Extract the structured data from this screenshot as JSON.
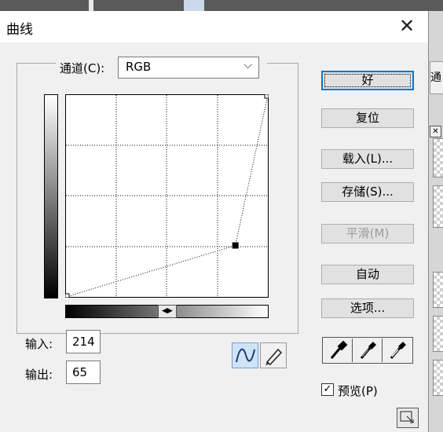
{
  "dialog": {
    "title": "曲线",
    "close_glyph": "✕"
  },
  "channel": {
    "label": "通道(C):",
    "value": "RGB"
  },
  "curve": {
    "points": [
      [
        0,
        0
      ],
      [
        214,
        65
      ],
      [
        255,
        255
      ]
    ],
    "scale_max": 255
  },
  "io": {
    "input_label": "输入:",
    "input_value": "214",
    "output_label": "输出:",
    "output_value": "65"
  },
  "buttons": {
    "ok": "好",
    "reset": "复位",
    "load": "载入(L)...",
    "save": "存储(S)...",
    "smooth": "平滑(M)",
    "auto": "自动",
    "options": "选项..."
  },
  "preview": {
    "checked": true,
    "label": "预览(P)"
  },
  "background": {
    "right_tab_glyph": "通"
  },
  "icons": {
    "curve_tool": "curve-icon",
    "pencil_tool": "pencil-icon",
    "eyedroppers": [
      "black-eyedropper-icon",
      "gray-eyedropper-icon",
      "white-eyedropper-icon"
    ]
  }
}
